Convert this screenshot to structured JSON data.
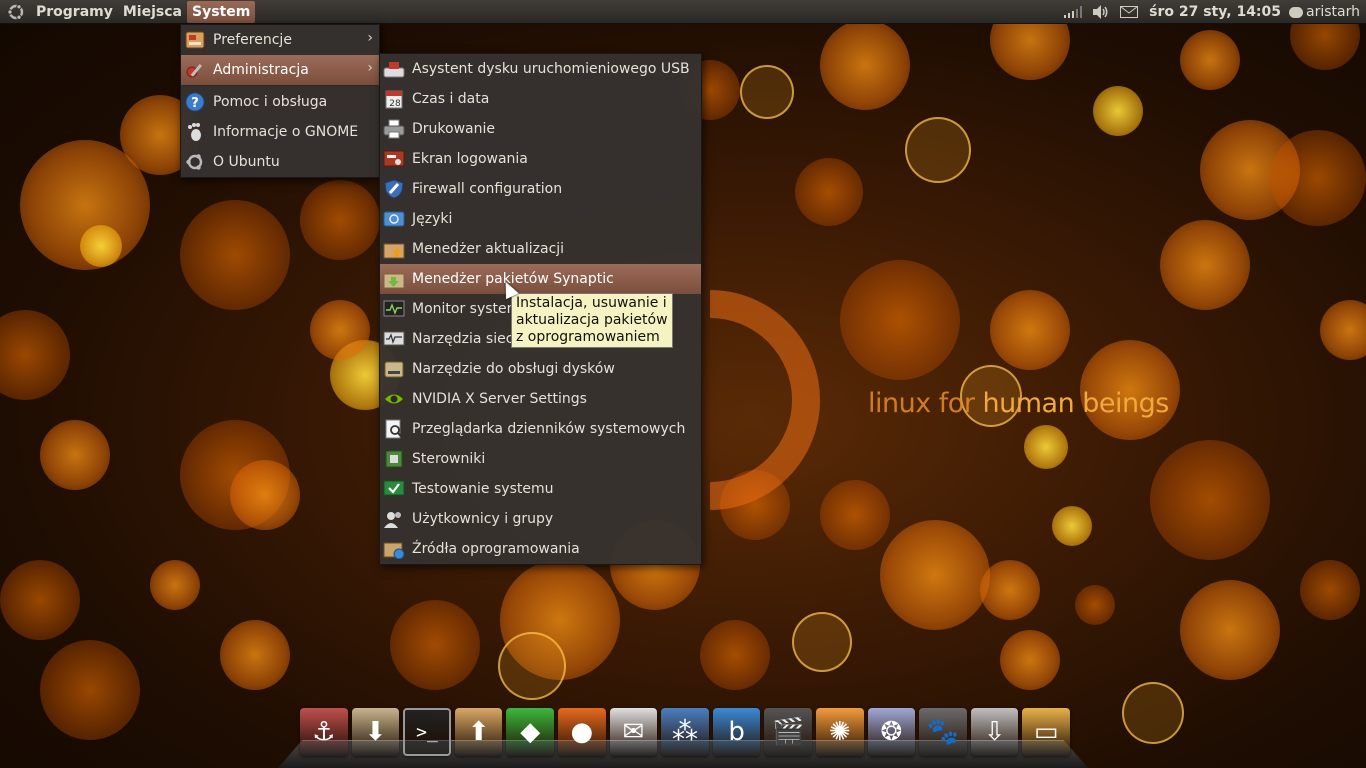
{
  "top_panel": {
    "menus": [
      "Programy",
      "Miejsca",
      "System"
    ],
    "active_menu": "System",
    "clock": "śro 27 sty, 14:05",
    "user": "aristarh",
    "tray_icons": [
      "network-signal-icon",
      "volume-icon",
      "mail-icon"
    ]
  },
  "system_menu": {
    "items": [
      {
        "label": "Preferencje",
        "icon": "preferences-icon",
        "submenu": true
      },
      {
        "label": "Administracja",
        "icon": "administration-icon",
        "submenu": true,
        "highlighted": true
      },
      {
        "label": "Pomoc i obsługa",
        "icon": "help-icon"
      },
      {
        "label": "Informacje o GNOME",
        "icon": "gnome-footprint-icon"
      },
      {
        "label": "O Ubuntu",
        "icon": "ubuntu-logo-icon"
      }
    ]
  },
  "admin_menu": {
    "items": [
      {
        "label": "Asystent dysku uruchomieniowego USB",
        "icon": "usb-disk-icon"
      },
      {
        "label": "Czas i data",
        "icon": "calendar-icon"
      },
      {
        "label": "Drukowanie",
        "icon": "printer-icon"
      },
      {
        "label": "Ekran logowania",
        "icon": "login-screen-icon"
      },
      {
        "label": "Firewall configuration",
        "icon": "firewall-shield-icon"
      },
      {
        "label": "Języki",
        "icon": "languages-icon"
      },
      {
        "label": "Menedżer aktualizacji",
        "icon": "update-manager-icon"
      },
      {
        "label": "Menedżer pakietów Synaptic",
        "icon": "synaptic-icon",
        "highlighted": true
      },
      {
        "label": "Monitor systemu",
        "icon": "system-monitor-icon"
      },
      {
        "label": "Narzędzia sieciowe",
        "icon": "network-tools-icon"
      },
      {
        "label": "Narzędzie do obsługi dysków",
        "icon": "disk-utility-icon"
      },
      {
        "label": "NVIDIA X Server Settings",
        "icon": "nvidia-icon"
      },
      {
        "label": "Przeglądarka dzienników systemowych",
        "icon": "log-viewer-icon"
      },
      {
        "label": "Sterowniki",
        "icon": "drivers-icon"
      },
      {
        "label": "Testowanie systemu",
        "icon": "system-testing-icon"
      },
      {
        "label": "Użytkownicy i grupy",
        "icon": "users-icon"
      },
      {
        "label": "Źródła oprogramowania",
        "icon": "software-sources-icon"
      }
    ]
  },
  "tooltip": "Instalacja, usuwanie i aktualizacja pakietów z oprogramowaniem",
  "wallpaper": {
    "slogan_part1": "linux for ",
    "slogan_part2": "human beings"
  },
  "dock": {
    "items": [
      {
        "name": "anchor-icon",
        "color": "#c0504d",
        "glyph": "⚓"
      },
      {
        "name": "download-box-icon",
        "color": "#c8b48c",
        "glyph": "⬇"
      },
      {
        "name": "terminal-icon",
        "color": "#222222",
        "glyph": ">_"
      },
      {
        "name": "update-box-icon",
        "color": "#d9a866",
        "glyph": "⬆"
      },
      {
        "name": "emerald-icon",
        "color": "#3cb83c",
        "glyph": "◆"
      },
      {
        "name": "firefox-icon",
        "color": "#e66a1e",
        "glyph": "●"
      },
      {
        "name": "mail-client-icon",
        "color": "#e0e0e0",
        "glyph": "✉"
      },
      {
        "name": "messenger-icon",
        "color": "#4a7fc1",
        "glyph": "⁂"
      },
      {
        "name": "banshee-icon",
        "color": "#3a8ad6",
        "glyph": "b"
      },
      {
        "name": "video-editor-icon",
        "color": "#555555",
        "glyph": "🎬"
      },
      {
        "name": "brasero-icon",
        "color": "#f29b3c",
        "glyph": "✺"
      },
      {
        "name": "aperture-icon",
        "color": "#9fa8d8",
        "glyph": "❂"
      },
      {
        "name": "gimp-icon",
        "color": "#6b6b6b",
        "glyph": "🐾"
      },
      {
        "name": "installer-icon",
        "color": "#c0c0c0",
        "glyph": "⇩"
      },
      {
        "name": "home-folder-icon",
        "color": "#e8b04a",
        "glyph": "▭"
      }
    ]
  }
}
